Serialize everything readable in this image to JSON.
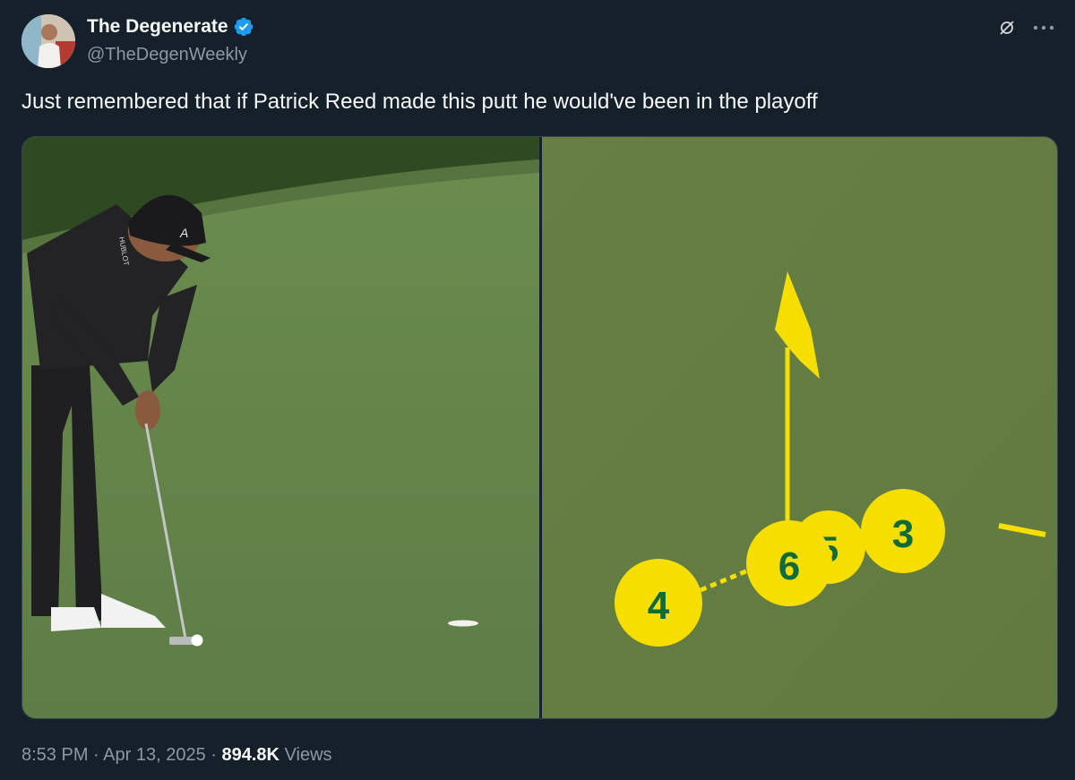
{
  "author": {
    "name": "The Degenerate",
    "handle": "@TheDegenWeekly",
    "verified": true,
    "verified_color": "#1d9bf0"
  },
  "header_actions": {
    "grok_icon": "grok-icon",
    "more_icon": "more-horizontal-icon"
  },
  "tweet": {
    "text": "Just remembered that if Patrick Reed made this putt he would've been in the playoff"
  },
  "media": {
    "shot_tracer_markers": [
      "4",
      "6",
      "5",
      "3"
    ],
    "cap_logo_text": "A",
    "shirt_text": "HUBLOT",
    "marker_color": "#f5de00",
    "marker_text_color": "#0e6b3a"
  },
  "meta": {
    "time": "8:53 PM",
    "separator": "·",
    "date": "Apr 13, 2025",
    "views_count": "894.8K",
    "views_label": "Views"
  },
  "colors": {
    "background": "#15202b",
    "text_primary": "#f7f9f9",
    "text_secondary": "#8b98a5"
  }
}
